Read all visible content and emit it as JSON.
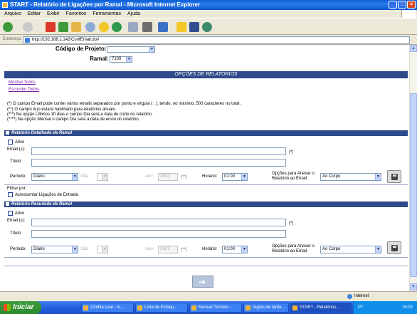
{
  "window": {
    "title": "START - Relatório de Ligações por Ramal - Microsoft Internet Explorer"
  },
  "menu": [
    "Arquivo",
    "Editar",
    "Exibir",
    "Favoritos",
    "Ferramentas",
    "Ajuda"
  ],
  "address": {
    "label": "Endereço",
    "url": "http://192.168.1.142/ConfEmail.do#"
  },
  "top_filters": {
    "codigo_label": "Código de Projeto:",
    "codigo_value": "",
    "ramal_label": "Ramal:",
    "ramal_value": "7100"
  },
  "options_header": "OPÇÕES DE RELATÓRIOS",
  "links": {
    "show_all": "Mostrar Todos",
    "hide_all": "Esconder Todos"
  },
  "notes": [
    "(*) O campo Email pode conter vários emails separados por ponto e vírgula ( ; ), tendo, no máximo, 500 caracteres no total.",
    "(**) O campo Ano estará habilitado para relatórios anuais.",
    "(***) Na opção Últimos 30 dias o campo Dia será a data de corte do relatório.",
    "(****) Na opção Mensal o campo Dia será a data de envio do relatório."
  ],
  "sections": [
    {
      "title": "Relatório Detalhado de Ramal",
      "ativo_label": "Ativo",
      "email_label": "Email (s):",
      "email_mark": "(*)",
      "titulo_label": "Título:",
      "periodo_label": "Período:",
      "periodo_value": "Diário",
      "dia_label": "Dia:",
      "ano_label": "Ano:",
      "ano_value": "2007",
      "ano_mark": "(**)",
      "horario_label": "Horário:",
      "horario_value": "01:00",
      "opcoes_label": "Opções para Anexar o Relatório ao Email:",
      "opcoes_value": "Ao Corpo",
      "filtrar_label": "Filtrar por:",
      "acrescentar_label": "Acrescentar Ligações de Entrada"
    },
    {
      "title": "Relatório Resumido de Ramal",
      "ativo_label": "Ativo",
      "email_label": "Email (s):",
      "email_mark": "(*)",
      "titulo_label": "Título:",
      "periodo_label": "Período:",
      "periodo_value": "Diário",
      "dia_label": "Dia:",
      "ano_label": "Ano:",
      "ano_value": "2007",
      "ano_mark": "(**)",
      "horario_label": "Horário:",
      "horario_value": "01:00",
      "opcoes_label": "Opções para Anexar o Relatório ao Email:",
      "opcoes_value": "Ao Corpo"
    }
  ],
  "status": {
    "zone": "Internet"
  },
  "taskbar": {
    "start": "Iniciar",
    "tasks": [
      "Cinthia Leal - In...",
      "Lista de Estoqu...",
      "Manual Técnico ...",
      "regras de tarifa...",
      "START - Relatórios..."
    ],
    "clock": "16:02",
    "lang": "PT"
  }
}
